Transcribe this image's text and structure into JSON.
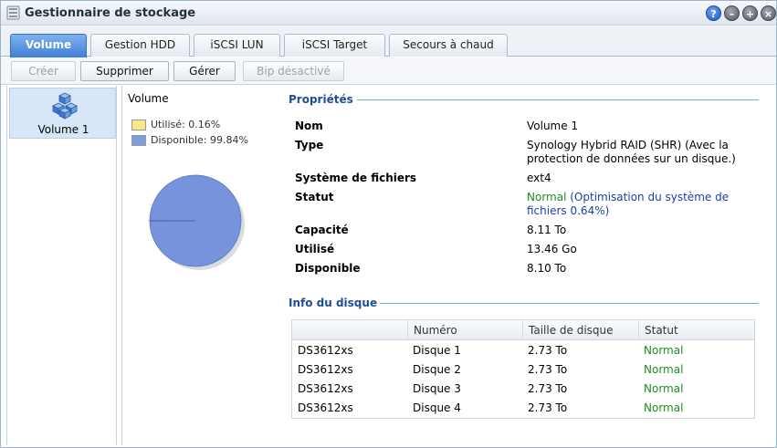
{
  "window": {
    "title": "Gestionnaire de stockage",
    "icon": "storage-manager-icon"
  },
  "window_buttons": [
    "help-icon",
    "minimize-icon",
    "maximize-icon",
    "close-icon"
  ],
  "tabs": [
    {
      "label": "Volume",
      "active": true
    },
    {
      "label": "Gestion HDD",
      "active": false
    },
    {
      "label": "iSCSI LUN",
      "active": false
    },
    {
      "label": "iSCSI Target",
      "active": false
    },
    {
      "label": "Secours à chaud",
      "active": false
    }
  ],
  "toolbar": {
    "create": "Créer",
    "delete": "Supprimer",
    "manage": "Gérer",
    "beep": "Bip désactivé"
  },
  "volumes": [
    {
      "label": "Volume 1",
      "selected": true
    }
  ],
  "chart": {
    "title": "Volume",
    "legend": [
      {
        "label": "Utilisé: 0.16%",
        "color": "#f7e98a"
      },
      {
        "label": "Disponible: 99.84%",
        "color": "#7f9ee0"
      }
    ]
  },
  "chart_data": {
    "type": "pie",
    "categories": [
      "Utilisé",
      "Disponible"
    ],
    "values": [
      0.16,
      99.84
    ],
    "colors": [
      "#f2d24b",
      "#7693dc"
    ]
  },
  "properties": {
    "title": "Propriétés",
    "name_key": "Nom",
    "name_val": "Volume 1",
    "type_key": "Type",
    "type_val": "Synology Hybrid RAID (SHR) (Avec la protection de données sur un disque.)",
    "fs_key": "Système de fichiers",
    "fs_val": "ext4",
    "status_key": "Statut",
    "status_val": "Normal",
    "status_detail": "(Optimisation du système de fichiers 0.64%)",
    "cap_key": "Capacité",
    "cap_val": "8.11 To",
    "used_key": "Utilisé",
    "used_val": "13.46 Go",
    "avail_key": "Disponible",
    "avail_val": "8.10 To"
  },
  "disk_info": {
    "title": "Info du disque",
    "headers": [
      "",
      "Numéro",
      "Taille de disque",
      "Statut"
    ],
    "rows": [
      [
        "DS3612xs",
        "Disque 1",
        "2.73 To",
        "Normal"
      ],
      [
        "DS3612xs",
        "Disque 2",
        "2.73 To",
        "Normal"
      ],
      [
        "DS3612xs",
        "Disque 3",
        "2.73 To",
        "Normal"
      ],
      [
        "DS3612xs",
        "Disque 4",
        "2.73 To",
        "Normal"
      ]
    ]
  }
}
